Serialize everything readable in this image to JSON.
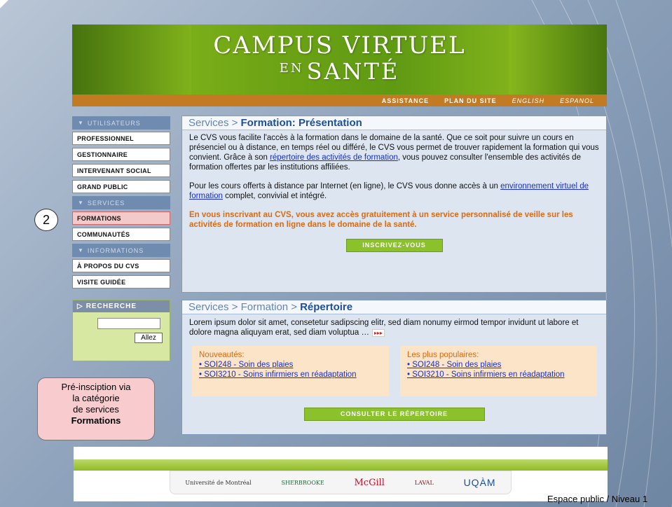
{
  "banner": {
    "title": "CAMPUS VIRTUEL",
    "subtitle_small": "EN",
    "subtitle": "SANTÉ"
  },
  "topnav": {
    "assistance": "ASSISTANCE",
    "plan": "PLAN DU SITE",
    "english": "ENGLISH",
    "espanol": "ESPANOL"
  },
  "sidebar": {
    "head_users": "UTILISATEURS",
    "users": [
      "PROFESSIONNEL",
      "GESTIONNAIRE",
      "INTERVENANT SOCIAL",
      "GRAND PUBLIC"
    ],
    "head_services": "SERVICES",
    "services": [
      "FORMATIONS",
      "COMMUNAUTÉS"
    ],
    "head_info": "INFORMATIONS",
    "info": [
      "À PROPOS DU CVS",
      "VISITE GUIDÉE"
    ]
  },
  "recherche": {
    "title": "RECHERCHE",
    "input_value": "",
    "button": "Allez"
  },
  "callouts": {
    "step_number": "2",
    "note_line1": "Pré-insciption via",
    "note_line2": "la catégorie",
    "note_line3": "de services",
    "note_bold": "Formations"
  },
  "panel1": {
    "crumb": "Services >",
    "title": "Formation: Présentation",
    "para1_a": "Le CVS vous facilite l'accès à la formation dans le domaine de la santé. Que ce soit pour suivre un cours en présenciel ou à distance, en temps réel ou différé, le CVS vous permet de trouver rapidement la formation qui vous convient. Grâce à son ",
    "para1_link": "répertoire des activités de formation",
    "para1_b": ", vous pouvez consulter l'ensemble des activités de formation offertes par les institutions affiliées.",
    "para2_a": "Pour les cours offerts à distance par Internet (en ligne), le CVS vous donne accès à un ",
    "para2_link": "environnement virtuel de formation",
    "para2_b": " complet, convivial et intégré.",
    "highlight": "En vous inscrivant au CVS, vous avez accès gratuitement à un service personnalisé de veille sur les activités de formation en ligne dans le domaine de la santé.",
    "button": "INSCRIVEZ-VOUS"
  },
  "panel2": {
    "crumb": "Services > Formation >",
    "title": "Répertoire",
    "lorem": "Lorem ipsum dolor sit amet, consetetur sadipscing elitr,  sed diam nonumy eirmod tempor invidunt ut labore et dolore magna aliquyam erat, sed diam voluptua …",
    "more": "▸▸▸",
    "new_title": "Nouveautés:",
    "new_items": [
      "• SOI248   - Soin des plaies",
      "• SOI3210 - Soins infirmiers en réadaptation"
    ],
    "pop_title": "Les plus populaires:",
    "pop_items": [
      "• SOI248   - Soin des plaies",
      "• SOI3210 - Soins infirmiers en réadaptation"
    ],
    "button": "CONSULTER LE RÉPERTOIRE"
  },
  "footer": {
    "universities": [
      "Université de Montréal",
      "SHERBROOKE",
      "McGill",
      "LAVAL",
      "UQÀM"
    ]
  },
  "level_tag": "Espace public / Niveau 1"
}
